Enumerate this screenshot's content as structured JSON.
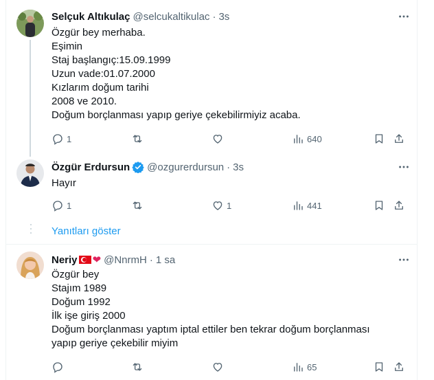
{
  "tweets": [
    {
      "name": "Selçuk Altıkulaç",
      "handle": "@selcukaltikulac",
      "time": "3s",
      "lines": [
        "Özgür bey merhaba.",
        "Eşimin",
        "Staj başlangıç:15.09.1999",
        "Uzun vade:01.07.2000",
        "Kızlarım doğum tarihi",
        "2008 ve 2010.",
        "Doğum borçlanması yapıp geriye çekebilirmiyiz acaba."
      ],
      "replies": "1",
      "retweets": "",
      "likes": "",
      "views": "640"
    },
    {
      "name": "Özgür Erdursun",
      "handle": "@ozgurerdursun",
      "time": "3s",
      "verified": true,
      "lines": [
        "Hayır"
      ],
      "replies": "1",
      "retweets": "",
      "likes": "1",
      "views": "441"
    },
    {
      "name": "Neriy",
      "name_emoji": [
        "turkish-flag",
        "red-heart"
      ],
      "handle": "@NnrmH",
      "time": "1 sa",
      "lines": [
        "Özgür bey",
        "Stajım 1989",
        "Doğum 1992",
        "İlk işe giriş 2000",
        "Doğum borçlanması yaptım iptal ettiler ben tekrar doğum borçlanması",
        "yapıp geriye çekebilir miyim"
      ],
      "replies": "",
      "retweets": "",
      "likes": "",
      "views": "65"
    }
  ],
  "show_replies_label": "Yanıtları göster",
  "colors": {
    "text": "#0f1419",
    "secondary": "#536471",
    "accent": "#1d9bf0",
    "divider": "#eff3f4",
    "thread_line": "#cfd9de"
  }
}
